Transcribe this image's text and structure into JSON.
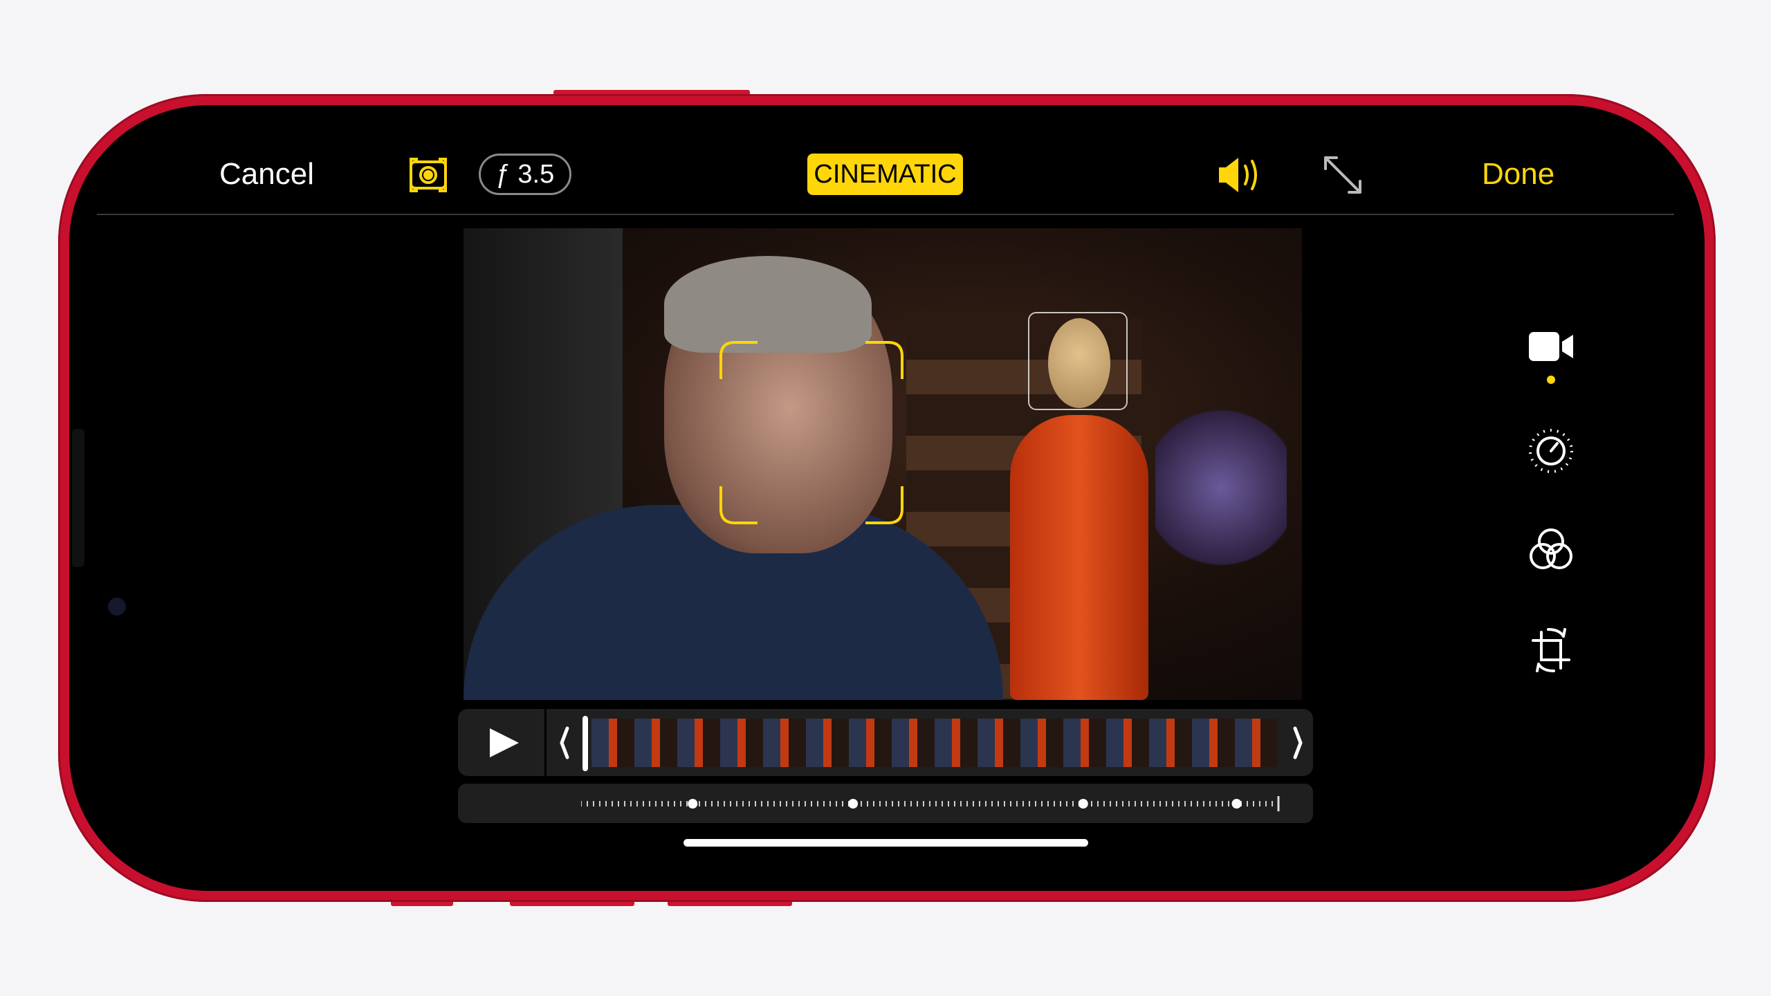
{
  "toolbar": {
    "cancel_label": "Cancel",
    "aperture_label": "ƒ 3.5",
    "mode_label": "CINEMATIC",
    "done_label": "Done"
  },
  "icons": {
    "focus": "focus-lock-icon",
    "audio": "speaker-wave-icon",
    "expand": "expand-arrows-icon",
    "video": "video-camera-icon",
    "adjust": "adjust-dial-icon",
    "filters": "filters-icon",
    "crop": "crop-rotate-icon",
    "play": "play-icon"
  },
  "colors": {
    "accent": "#ffd60a",
    "frame": "#c8102e",
    "background": "#f5f5f7"
  },
  "timeline": {
    "playhead_position": 0,
    "focus_points": [
      0.16,
      0.39,
      0.72,
      0.94
    ]
  },
  "side_tools": {
    "active": "video"
  }
}
